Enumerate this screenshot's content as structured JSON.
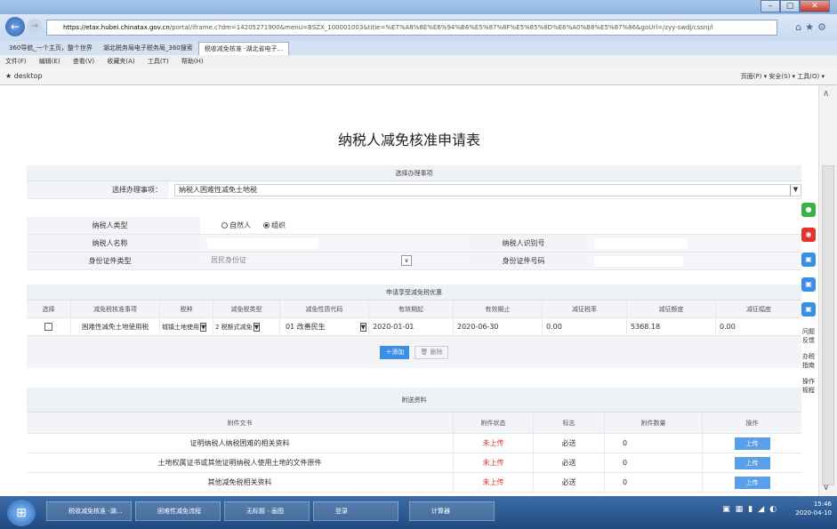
{
  "browser": {
    "url_site": "https://etax.hubei.chinatax.gov.cn",
    "url_rest": "/portal/iframe.c?dm=14205271900&menu=BSZX_100001003&title=%E7%A8%8E%E6%94%B6%E5%87%8F%E5%85%8D%E6%A0%B8%E5%87%86&goUrl=/zyy-swdj/cssnj/l",
    "tabs": [
      "360导航_一个主页，整个世界",
      "湖北税务局电子税务局_360搜索",
      "税收减免核准 -湖北省电子..."
    ],
    "menu": [
      "文件(F)",
      "编辑(E)",
      "查看(V)",
      "收藏夹(A)",
      "工具(T)",
      "帮助(H)"
    ],
    "favorite": "desktop",
    "toolbar_right": "页面(P) ▾   安全(S) ▾   工具(O) ▾"
  },
  "form": {
    "title": "纳税人减免核准申请表",
    "section1": {
      "header": "选择办理事项",
      "label": "选择办理事项：",
      "value": "纳税人困难性减免土地税"
    },
    "taxpayer": {
      "type_label": "纳税人类型",
      "opt_natural": "自然人",
      "opt_org": "组织",
      "name_label": "纳税人名称",
      "id_label": "纳税人识别号",
      "idtype_label": "身份证件类型",
      "idtype_value": "居民身份证",
      "idno_label": "身份证件号码"
    },
    "relief": {
      "header": "申请享受减免税优惠",
      "columns": [
        "选择",
        "减免税核准事项",
        "税种",
        "减免税类型",
        "减免性质代码",
        "有效期起",
        "有效期止",
        "减征税率",
        "减征额度",
        "减征幅度"
      ],
      "row": {
        "item": "困难性减免土地使用税",
        "tax": "城镇土地使用",
        "type": "2 税额式减免",
        "code": "01 改善民生",
        "start": "2020-01-01",
        "end": "2020-06-30",
        "rate": "0.00",
        "amount": "5368.18",
        "range": "0.00"
      },
      "add": "添加",
      "delete": "删除"
    },
    "attachments": {
      "header": "附送资料",
      "columns": [
        "附件文书",
        "附件状态",
        "标志",
        "附件数量",
        "操作"
      ],
      "rows": [
        {
          "doc": "证明纳税人纳税困难的相关资料",
          "status": "未上传",
          "flag": "必送",
          "count": "0",
          "action": "上传"
        },
        {
          "doc": "土地权属证书或其他证明纳税人使用土地的文件原件",
          "status": "未上传",
          "flag": "必送",
          "count": "0",
          "action": "上传"
        },
        {
          "doc": "其他减免税相关资料",
          "status": "未上传",
          "flag": "必送",
          "count": "0",
          "action": "上传"
        }
      ]
    }
  },
  "side_tools": [
    "问题反馈",
    "办税指南",
    "操作规程"
  ],
  "taskbar": {
    "items": [
      "税收减免核准 -湖...",
      "困难性减免流程",
      "无标题 - 画图",
      "登录",
      "计算器"
    ],
    "time": "15:46",
    "date": "2020-04-10"
  }
}
